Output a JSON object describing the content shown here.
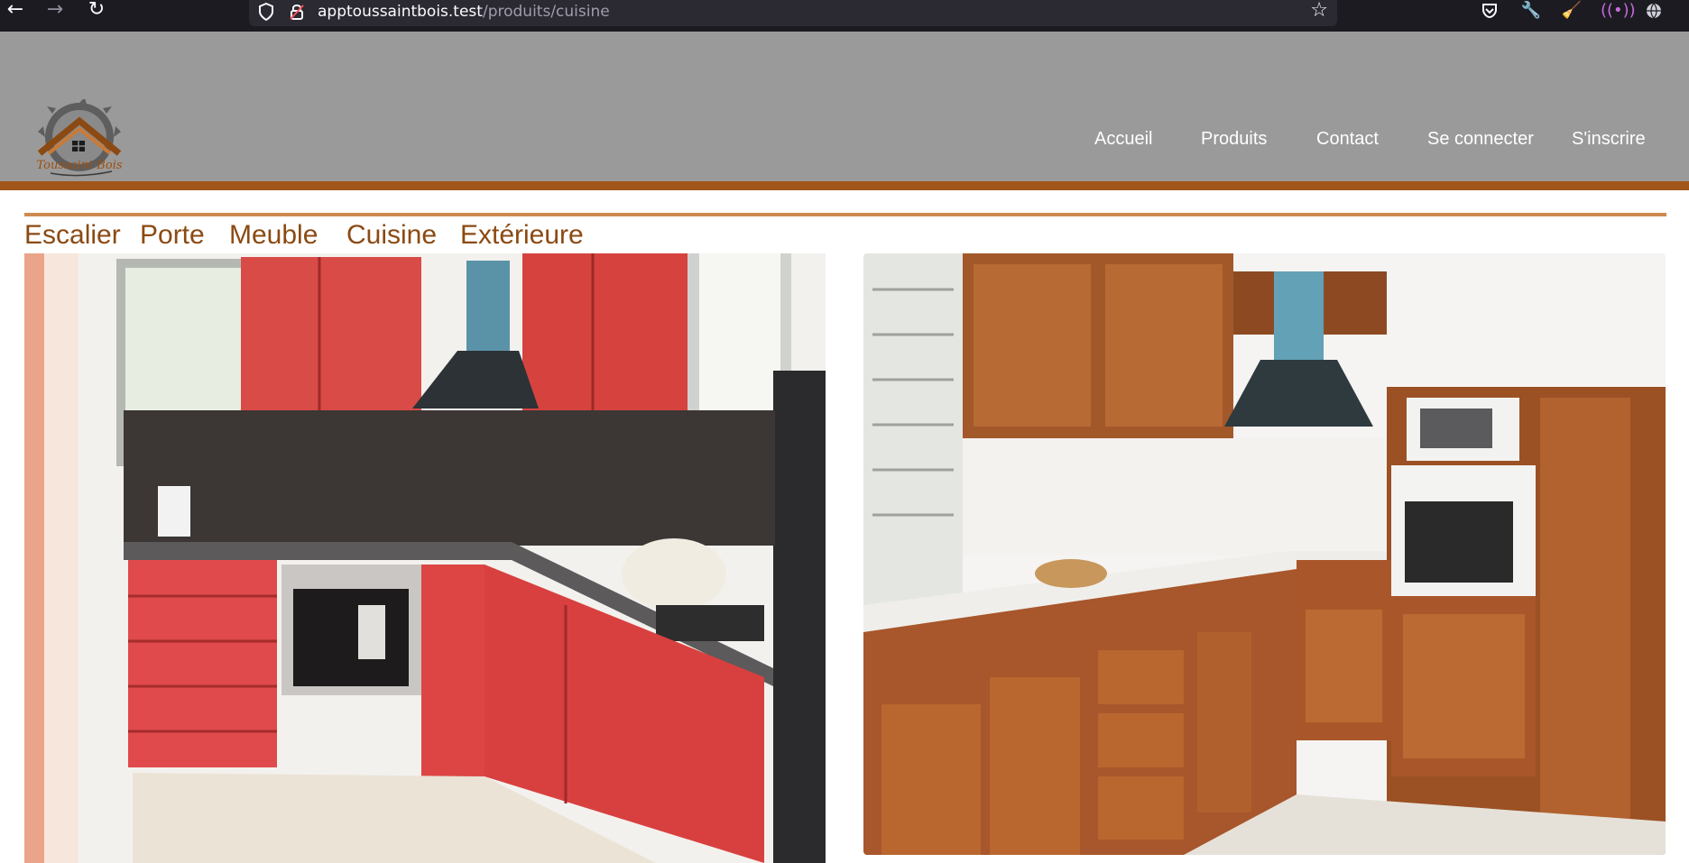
{
  "browser": {
    "url_host": "apptoussaintbois.test",
    "url_path": "/produits/cuisine"
  },
  "site": {
    "logo_text": "Toussaint Bois",
    "nav": [
      "Accueil",
      "Produits",
      "Contact",
      "Se connecter",
      "S'inscrire"
    ]
  },
  "categories": [
    "Escalier",
    "Porte",
    "Meuble",
    "Cuisine",
    "Extérieure"
  ],
  "products": [
    {
      "image": "red-kitchen-photo"
    },
    {
      "image": "wood-kitchen-photo"
    }
  ],
  "icons": [
    "back-icon",
    "forward-icon",
    "reload-icon",
    "shield-icon",
    "lock-icon",
    "star-icon",
    "pocket-icon",
    "wrench-icon",
    "extension-icon",
    "broadcast-icon",
    "globe-icon"
  ],
  "colors": {
    "header": "#9a9a9a",
    "accent": "#a0561a",
    "category_text": "#8b4a12",
    "category_line": "#cf8a4f"
  }
}
